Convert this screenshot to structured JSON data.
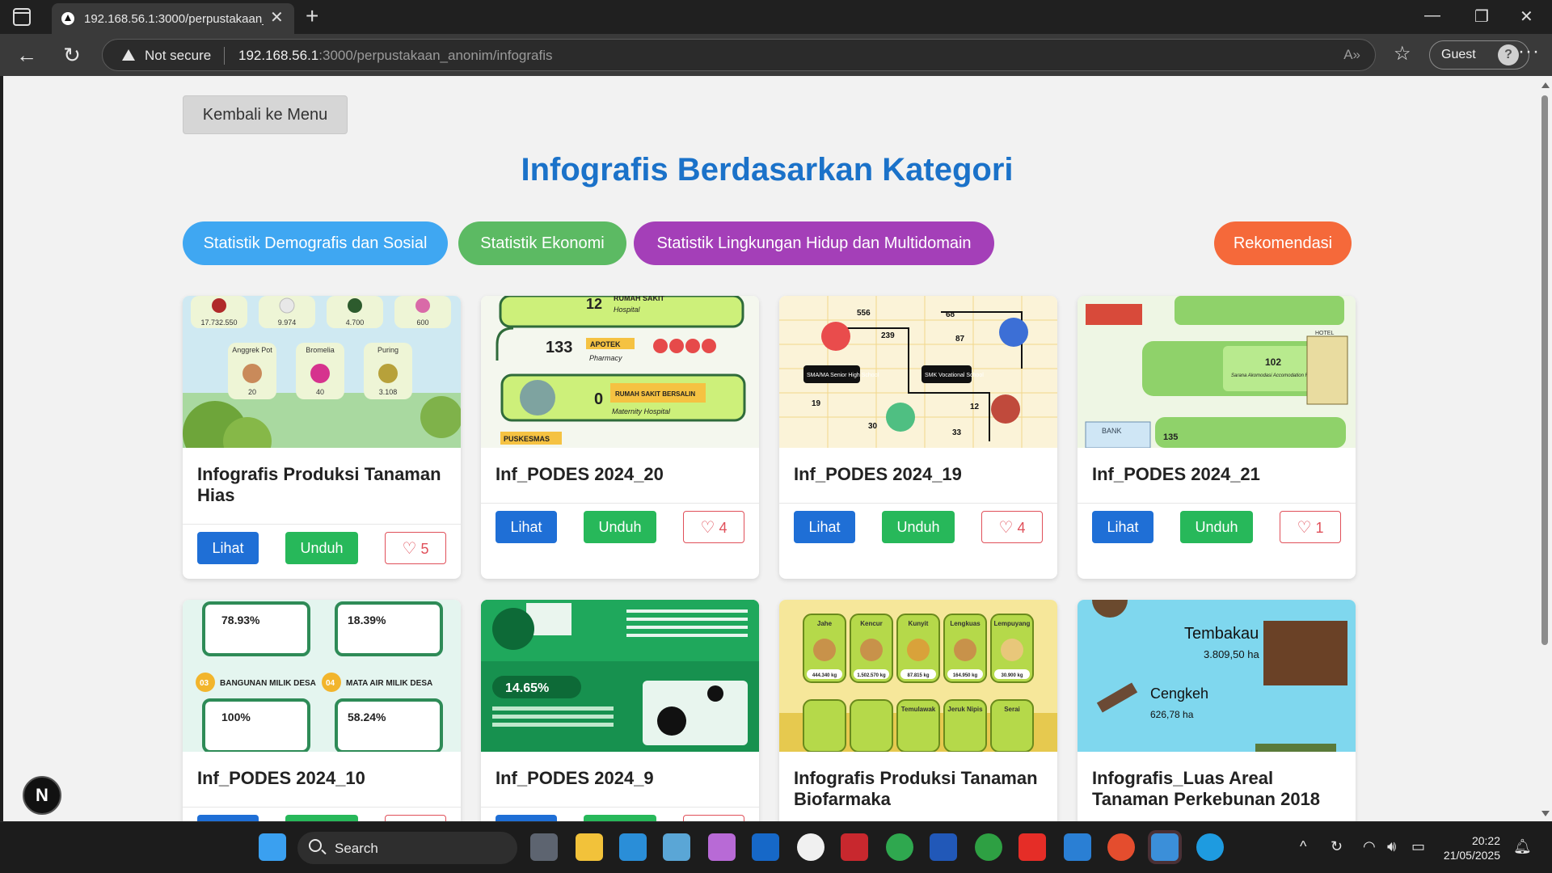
{
  "browser": {
    "tab_title": "192.168.56.1:3000/perpustakaan_",
    "security_label": "Not secure",
    "url_host": "192.168.56.1",
    "url_path": ":3000/perpustakaan_anonim/infografis",
    "profile_label": "Guest"
  },
  "page": {
    "back_label": "Kembali ke Menu",
    "title": "Infografis Berdasarkan Kategori",
    "categories": [
      {
        "label": "Statistik Demografis dan Sosial",
        "color": "#3fa7f2"
      },
      {
        "label": "Statistik Ekonomi",
        "color": "#5cba63"
      },
      {
        "label": "Statistik Lingkungan Hidup dan Multidomain",
        "color": "#a43fb8"
      }
    ],
    "recommend_label": "Rekomendasi",
    "view_label": "Lihat",
    "download_label": "Unduh",
    "cards": [
      {
        "title": "Infografis Produksi Tanaman Hias",
        "likes": "5",
        "thumb": {
          "values": [
            "17.732.550",
            "9.974",
            "4.700",
            "600",
            "20",
            "40",
            "3.108"
          ],
          "names": [
            "Anggrek Pot",
            "Bromelia",
            "Puring"
          ]
        }
      },
      {
        "title": "Inf_PODES 2024_20",
        "likes": "4",
        "thumb": {
          "values": [
            "12",
            "133",
            "0"
          ],
          "labels": [
            "RUMAH SAKIT",
            "Hospital",
            "APOTEK",
            "Pharmacy",
            "RUMAH SAKIT BERSALIN",
            "Maternity Hospital",
            "PUSKESMAS"
          ]
        }
      },
      {
        "title": "Inf_PODES 2024_19",
        "likes": "4",
        "thumb": {
          "values": [
            "556",
            "239",
            "68",
            "87",
            "19",
            "30",
            "12",
            "33"
          ],
          "labels": [
            "SMA/MA Senior High School",
            "SMK Vocational School"
          ]
        }
      },
      {
        "title": "Inf_PODES 2024_21",
        "likes": "1",
        "thumb": {
          "values": [
            "102",
            "135"
          ],
          "labels": [
            "Sarana Akomodasi Accomodation Facilities",
            "HOTEL",
            "BANK"
          ]
        }
      },
      {
        "title": "Inf_PODES 2024_10",
        "likes": "",
        "thumb": {
          "values": [
            "78.93%",
            "18.39%",
            "100%",
            "58.24%"
          ],
          "labels": [
            "03",
            "BANGUNAN MILIK DESA",
            "04",
            "MATA AIR MILIK DESA"
          ]
        }
      },
      {
        "title": "Inf_PODES 2024_9",
        "likes": "",
        "thumb": {
          "values": [
            "14.65%"
          ],
          "labels": []
        }
      },
      {
        "title": "Infografis Produksi Tanaman Biofarmaka",
        "likes": "",
        "thumb": {
          "values": [
            "444.340 kg",
            "1.502.570 kg",
            "87.815 kg",
            "164.950 kg",
            "30.900 kg"
          ],
          "names": [
            "Jahe",
            "Kencur",
            "Kunyit",
            "Lengkuas",
            "Lempuyang",
            "Temulawak",
            "Jeruk Nipis",
            "Serai"
          ]
        }
      },
      {
        "title": "Infografis_Luas Areal Tanaman Perkebunan 2018",
        "likes": "",
        "thumb": {
          "values": [
            "3.809,50 ha",
            "626,78 ha"
          ],
          "names": [
            "Tembakau",
            "Cengkeh"
          ]
        }
      }
    ]
  },
  "taskbar": {
    "search_label": "Search",
    "time": "20:22",
    "date": "21/05/2025"
  }
}
